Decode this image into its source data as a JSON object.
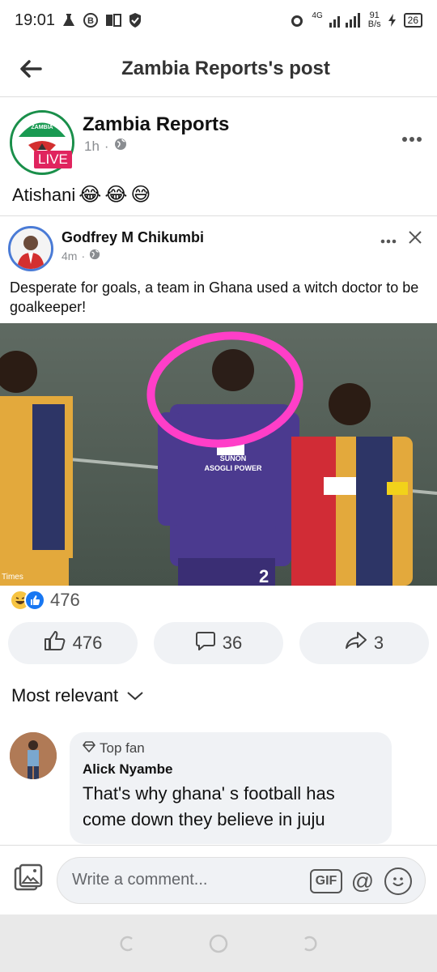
{
  "status": {
    "time": "19:01",
    "network": "4G",
    "speed_value": "91",
    "speed_unit": "B/s",
    "battery": "26"
  },
  "header": {
    "title": "Zambia Reports's post"
  },
  "post": {
    "page_name": "Zambia Reports",
    "avatar_text": "ZAMBIA",
    "live_label": "LIVE",
    "time": "1h",
    "dot": "·",
    "text": "Atishani",
    "emojis": [
      "😂",
      "😂",
      "😅"
    ]
  },
  "shared": {
    "author": "Godfrey M Chikumbi",
    "time": "4m",
    "dot": "·",
    "text": "Desperate for goals, a team in Ghana used a witch doctor to be goalkeeper!",
    "photo_text_left": "SUNON\nASOGLI POWER",
    "photo_number": "2",
    "photo_watermark": "Times"
  },
  "reactions": {
    "count": "476"
  },
  "actions": {
    "like_count": "476",
    "comment_count": "36",
    "share_count": "3"
  },
  "sort": {
    "label": "Most relevant"
  },
  "comment": {
    "badge": "Top fan",
    "author": "Alick Nyambe",
    "text": "That's why ghana' s football has come down they believe in juju"
  },
  "composer": {
    "placeholder": "Write a comment...",
    "gif_label": "GIF",
    "at_label": "@"
  },
  "colors": {
    "accent": "#1877f2",
    "live": "#e0245e",
    "bubble": "#f0f2f5",
    "circle": "#ff3ec8"
  }
}
